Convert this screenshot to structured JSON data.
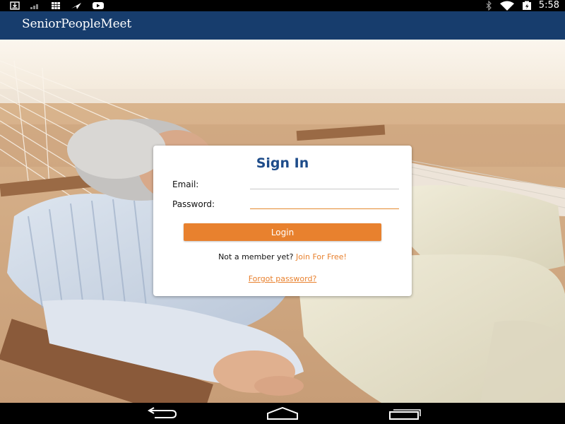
{
  "status_bar": {
    "left_icons": [
      "download-icon",
      "signal-bars-icon",
      "calendar-grid-icon",
      "send-icon",
      "youtube-icon"
    ],
    "right_icons": [
      "bluetooth-icon",
      "wifi-icon",
      "battery-icon"
    ],
    "time": "5:58"
  },
  "app_bar": {
    "title": "SeniorPeopleMeet",
    "color": "#173d6d"
  },
  "sign_in": {
    "title": "Sign In",
    "email_label": "Email:",
    "email_value": "",
    "password_label": "Password:",
    "password_value": "",
    "login_label": "Login",
    "member_prompt": "Not a member yet?",
    "join_label": "Join For Free!",
    "forgot_label": "Forgot password?",
    "accent_color": "#e8812e",
    "title_color": "#1e4c8a"
  },
  "nav_bar": {
    "buttons": [
      "back-icon",
      "home-icon",
      "recents-icon"
    ]
  }
}
